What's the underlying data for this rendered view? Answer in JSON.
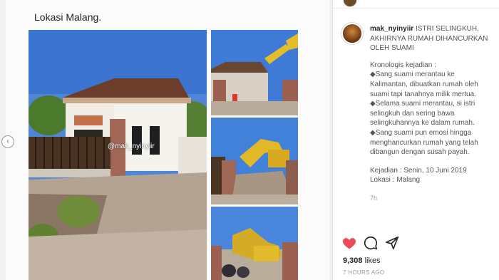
{
  "media": {
    "caption": "Lokasi Malang.",
    "watermark": "@mak_nyinyiir"
  },
  "post": {
    "username": "mak_nyinyiir",
    "headline": "ISTRI SELINGKUH, AKHIRNYA RUMAH DIHANCURKAN OLEH SUAMI",
    "headline_lines": [
      "ISTRI SELINGKUH,",
      "AKHIRNYA RUMAH DIHANCURKAN",
      "OLEH SUAMI"
    ],
    "body_lines": [
      "Kronologis kejadian :",
      "◆Sang suami merantau ke",
      "Kalimantan, dibuatkan rumah oleh",
      "suami tapi tanahnya milik mertua.",
      "◆Selama suami merantau, si istri",
      "selingkuh dan sering bawa",
      "selingkuhannya ke dalam rumah.",
      "◆Sang suami pun emosi hingga",
      "menghancurkan rumah yang telah",
      "dibangun dengan susah payah."
    ],
    "event_lines": [
      "Kejadian : Senin, 10 Juni 2019",
      "Lokasi : Malang"
    ],
    "time_ago": "7h",
    "likes_count": "9,308",
    "likes_label": "likes",
    "posted_ago": "7 HOURS AGO",
    "heart_color": "#ed4956"
  },
  "icons": {
    "like": "heart-icon",
    "comment": "comment-icon",
    "share": "share-icon",
    "prev": "chevron-left-icon"
  }
}
